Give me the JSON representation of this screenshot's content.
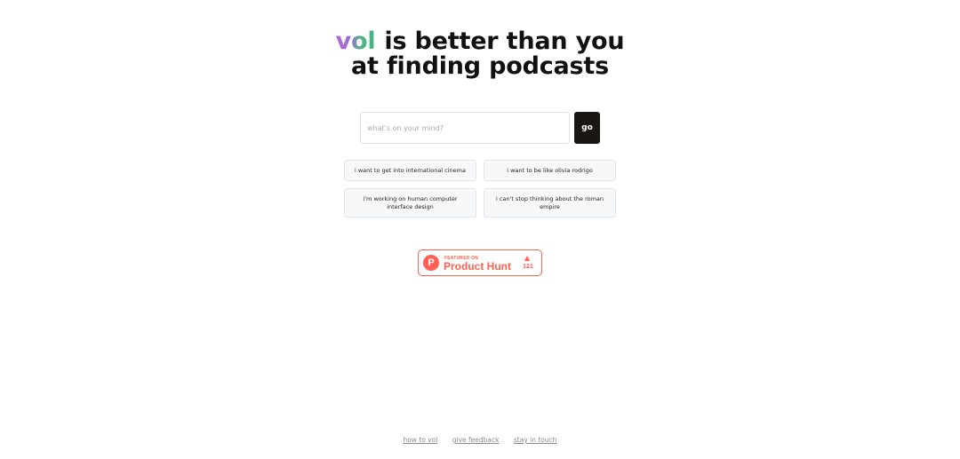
{
  "headline": {
    "brand": "vol",
    "line1_rest": "is better than you",
    "line2": "at finding podcasts"
  },
  "search": {
    "placeholder": "what's on your mind?",
    "value": "",
    "go_label": "go"
  },
  "suggestions": [
    "i want to get into international cinema",
    "i want to be like olivia rodrigo",
    "i'm working on human computer interface design",
    "i can't stop thinking about the roman empire"
  ],
  "product_hunt": {
    "featured_label": "FEATURED ON",
    "name": "Product Hunt",
    "upvotes": "121",
    "logo_letter": "P"
  },
  "footer": {
    "links": [
      "how to vol",
      "give feedback",
      "stay in touch"
    ]
  },
  "colors": {
    "brand_purple": "#b565d8",
    "brand_green": "#49b07f",
    "go_button": "#1a1613",
    "product_hunt": "#ff6154"
  }
}
